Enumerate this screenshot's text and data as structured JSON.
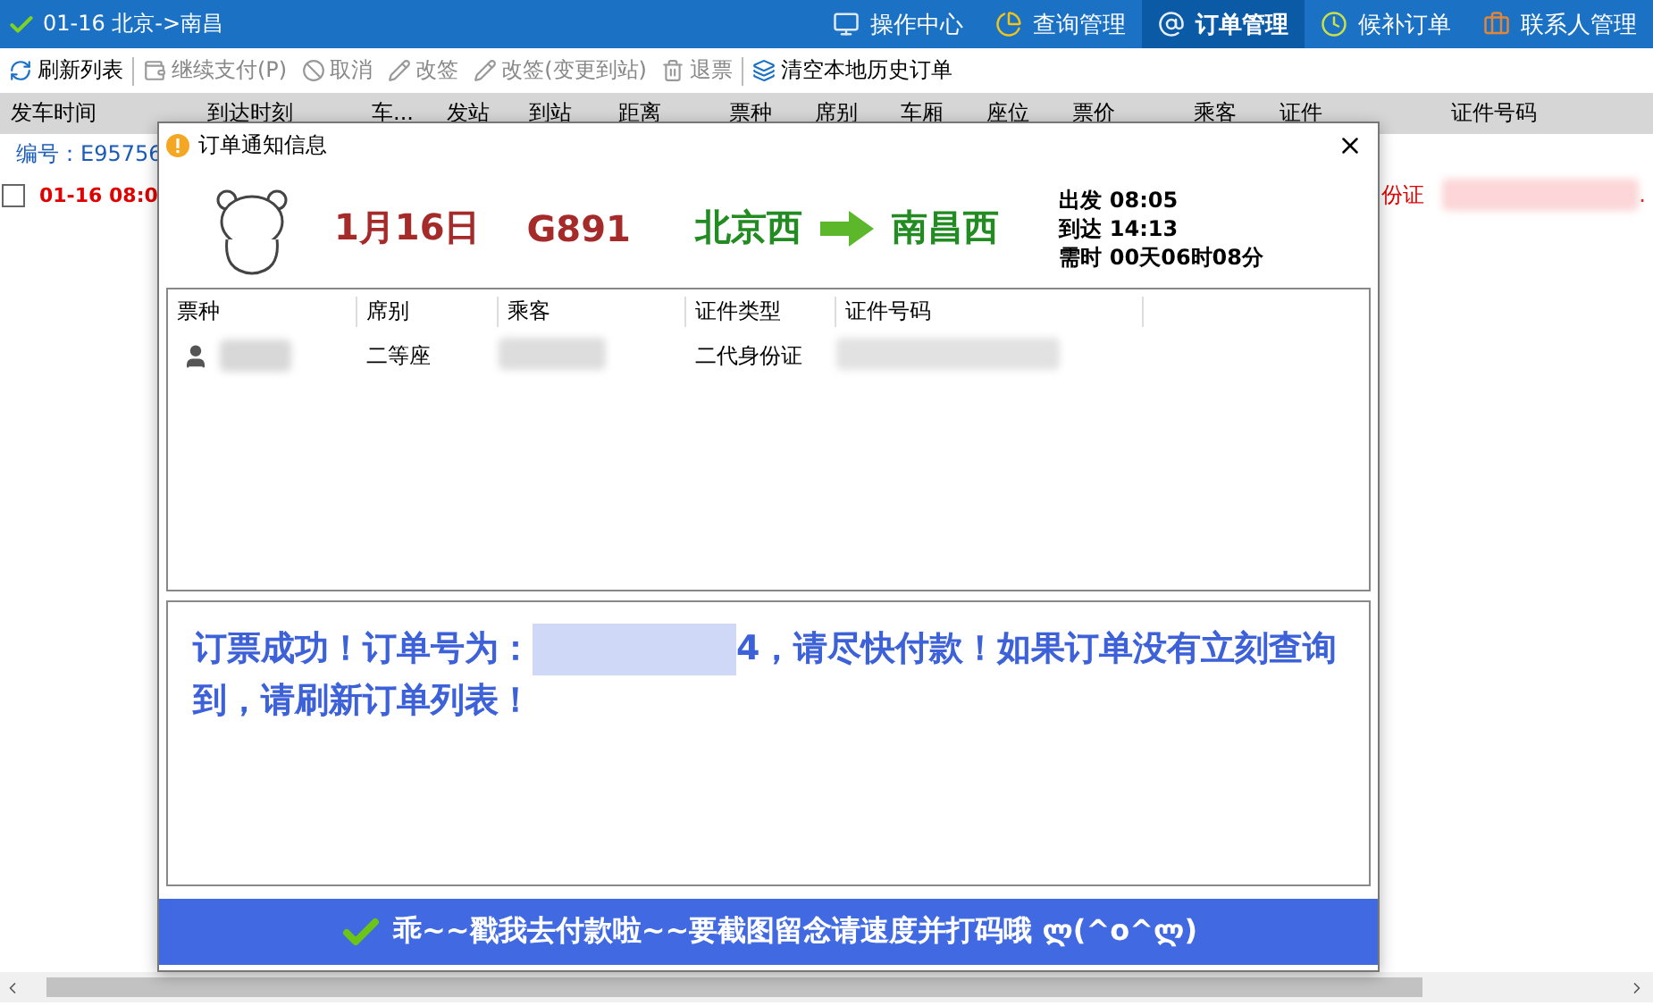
{
  "window": {
    "title": "01-16 北京->南昌"
  },
  "nav_tabs": [
    {
      "label": "操作中心",
      "selected": false
    },
    {
      "label": "查询管理",
      "selected": false
    },
    {
      "label": "订单管理",
      "selected": true
    },
    {
      "label": "候补订单",
      "selected": false
    },
    {
      "label": "联系人管理",
      "selected": false
    }
  ],
  "toolbar": [
    {
      "label": "刷新列表",
      "disabled": false
    },
    {
      "label": "继续支付(P)",
      "disabled": true
    },
    {
      "label": "取消",
      "disabled": true
    },
    {
      "label": "改签",
      "disabled": true
    },
    {
      "label": "改签(变更到站)",
      "disabled": true
    },
    {
      "label": "退票",
      "disabled": true
    },
    {
      "label": "清空本地历史订单",
      "disabled": false
    }
  ],
  "order_table": {
    "columns": [
      "发车时间",
      "到达时刻",
      "车...",
      "发站",
      "到站",
      "距离",
      "票种",
      "席别",
      "车厢",
      "座位",
      "票价",
      "乘客",
      "证件",
      "证件号码"
    ],
    "order_number": "编号：E95756",
    "rows": [
      {
        "checked": false,
        "departure": "01-16 08:0",
        "id_type": "份证",
        "id_number_end": "."
      }
    ]
  },
  "dialog": {
    "title": "订单通知信息",
    "date": "1月16日",
    "train": "G891",
    "from": "北京西",
    "to": "南昌西",
    "depart": "出发 08:05",
    "arrive": "到达 14:13",
    "duration": "需时 00天06时08分",
    "passenger_table": {
      "columns": [
        "票种",
        "席别",
        "乘客",
        "证件类型",
        "证件号码"
      ],
      "rows": [
        {
          "seat": "二等座",
          "id_type": "二代身份证"
        }
      ]
    },
    "message_before": "订票成功！订单号为：",
    "message_after": "4，请尽快付款！如果订单没有立刻查询到，请刷新订单列表！",
    "pay_button": "乖~~戳我去付款啦~~要截图留念请速度并打码哦 ლ(^o^ლ)"
  }
}
